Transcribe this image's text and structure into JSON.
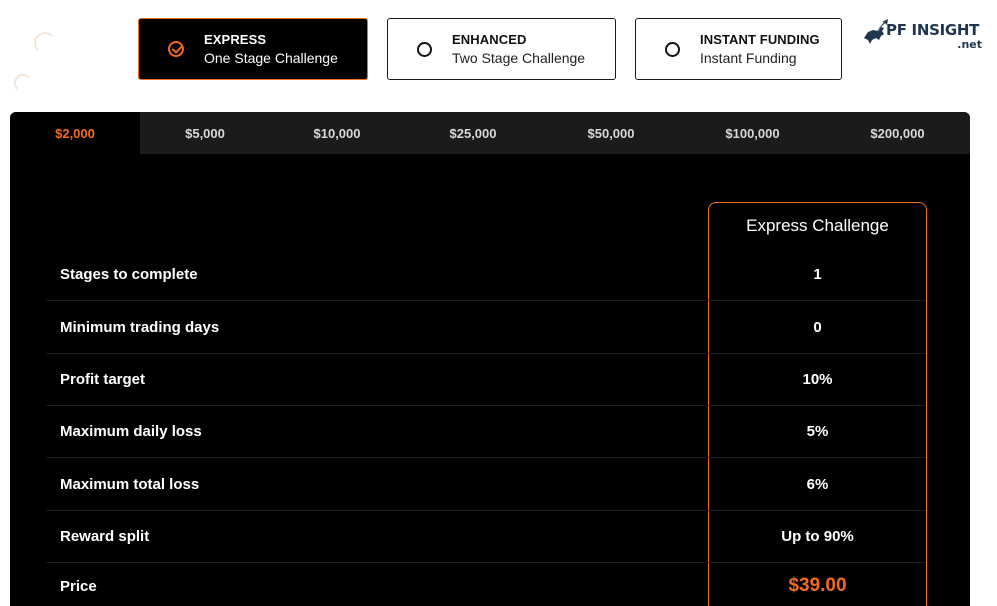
{
  "plans": [
    {
      "title": "EXPRESS",
      "subtitle": "One Stage Challenge",
      "selected": true
    },
    {
      "title": "ENHANCED",
      "subtitle": "Two Stage Challenge",
      "selected": false
    },
    {
      "title": "INSTANT FUNDING",
      "subtitle": "Instant Funding",
      "selected": false
    }
  ],
  "logo": {
    "brand": "PF INSIGHT",
    "domain": ".net",
    "icon": "bull-icon"
  },
  "tabs": [
    "$2,000",
    "$5,000",
    "$10,000",
    "$25,000",
    "$50,000",
    "$100,000",
    "$200,000"
  ],
  "active_tab": "$2,000",
  "column_title": "Express Challenge",
  "rows": [
    {
      "label": "Stages to complete",
      "value": "1"
    },
    {
      "label": "Minimum trading days",
      "value": "0"
    },
    {
      "label": "Profit target",
      "value": "10%"
    },
    {
      "label": "Maximum daily loss",
      "value": "5%"
    },
    {
      "label": "Maximum total loss",
      "value": "6%"
    },
    {
      "label": "Reward split",
      "value": "Up to 90%"
    },
    {
      "label": "Price",
      "value": "$39.00"
    }
  ],
  "colors": {
    "accent": "#f26b1d",
    "panel": "#000000",
    "tab_bg": "#1b1b1b",
    "logo": "#1f3550"
  }
}
